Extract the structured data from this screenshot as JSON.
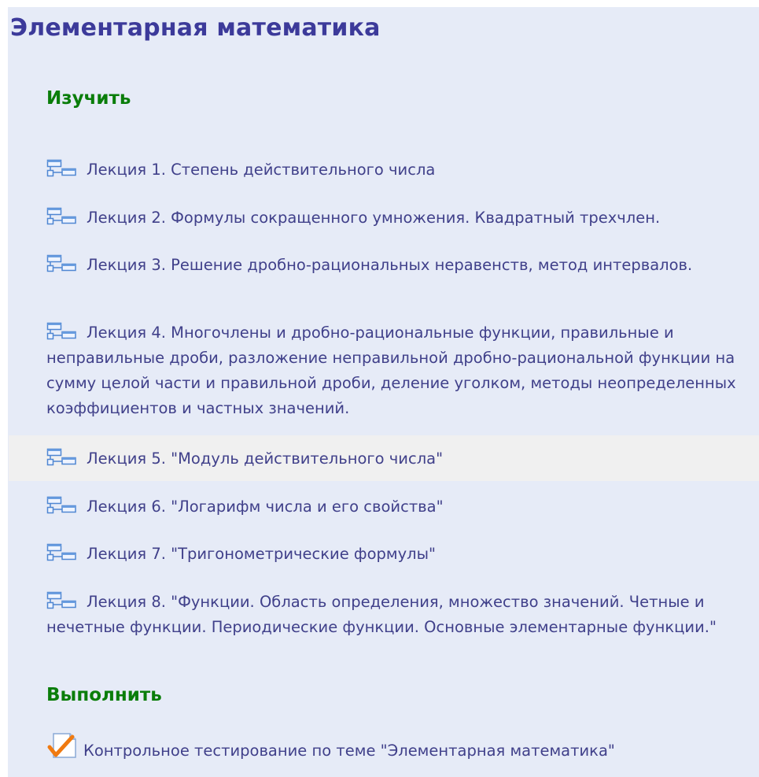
{
  "course": {
    "title": "Элементарная математика"
  },
  "sections": [
    {
      "heading": "Изучить",
      "items": [
        {
          "icon": "lecture-icon",
          "label": "Лекция 1. Степень действительного числа"
        },
        {
          "icon": "lecture-icon",
          "label": "Лекция 2. Формулы сокращенного умножения. Квадратный трехчлен."
        },
        {
          "icon": "lecture-icon",
          "label": "Лекция 3. Решение дробно-рациональных неравенств, метод интервалов."
        },
        {
          "icon": "lecture-icon",
          "label": "Лекция 4. Многочлены и дробно-рациональные функции, правильные и неправильные дроби, разложение неправильной дробно-рациональной функции на сумму целой части и правильной дроби, деление уголком, методы неопределенных коэффициентов и частных значений."
        },
        {
          "icon": "lecture-icon",
          "label": "Лекция 5. \"Модуль действительного числа\"",
          "hovered": true
        },
        {
          "icon": "lecture-icon",
          "label": "Лекция 6. \"Логарифм числа и его свойства\""
        },
        {
          "icon": "lecture-icon",
          "label": "Лекция 7. \"Тригонометрические формулы\""
        },
        {
          "icon": "lecture-icon",
          "label": "Лекция 8. \"Функции. Область определения, множество значений. Четные и нечетные функции. Периодические функции. Основные элементарные функции.\""
        }
      ]
    },
    {
      "heading": "Выполнить",
      "items": [
        {
          "icon": "quiz-checkmark-icon",
          "label": "Контрольное тестирование по теме \"Элементарная математика\""
        }
      ]
    }
  ],
  "colors": {
    "panel_bg": "#e6ebf7",
    "title": "#3c3a9a",
    "section_heading": "#0a7d0a",
    "link_text": "#40408a",
    "hover_row": "#f0f0f0",
    "icon_blue": "#5a8fd6",
    "checkmark_orange": "#f07a10"
  }
}
